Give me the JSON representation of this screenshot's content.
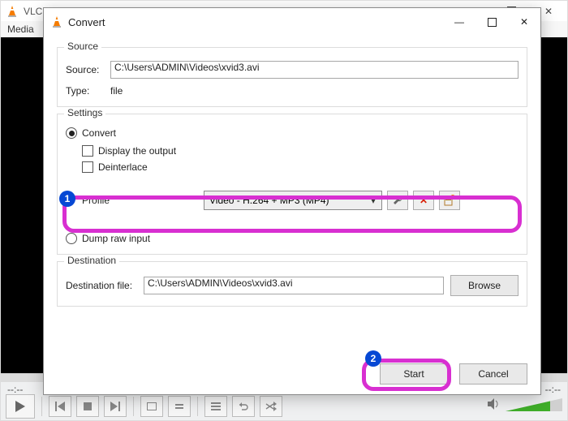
{
  "main": {
    "title": "VLC media player",
    "menu_media": "Media",
    "time_left": "--:--",
    "time_right": "--:--"
  },
  "dialog": {
    "title": "Convert",
    "source": {
      "legend": "Source",
      "label": "Source:",
      "value": "C:\\Users\\ADMIN\\Videos\\xvid3.avi",
      "type_label": "Type:",
      "type_value": "file"
    },
    "settings": {
      "legend": "Settings",
      "convert": "Convert",
      "display_output": "Display the output",
      "deinterlace": "Deinterlace",
      "profile_label": "Profile",
      "profile_value": "Video - H.264 + MP3 (MP4)",
      "dump_raw": "Dump raw input"
    },
    "dest": {
      "legend": "Destination",
      "label": "Destination file:",
      "value": "C:\\Users\\ADMIN\\Videos\\xvid3.avi",
      "browse": "Browse"
    },
    "buttons": {
      "start": "Start",
      "cancel": "Cancel"
    }
  },
  "annotations": {
    "one": "1",
    "two": "2"
  }
}
